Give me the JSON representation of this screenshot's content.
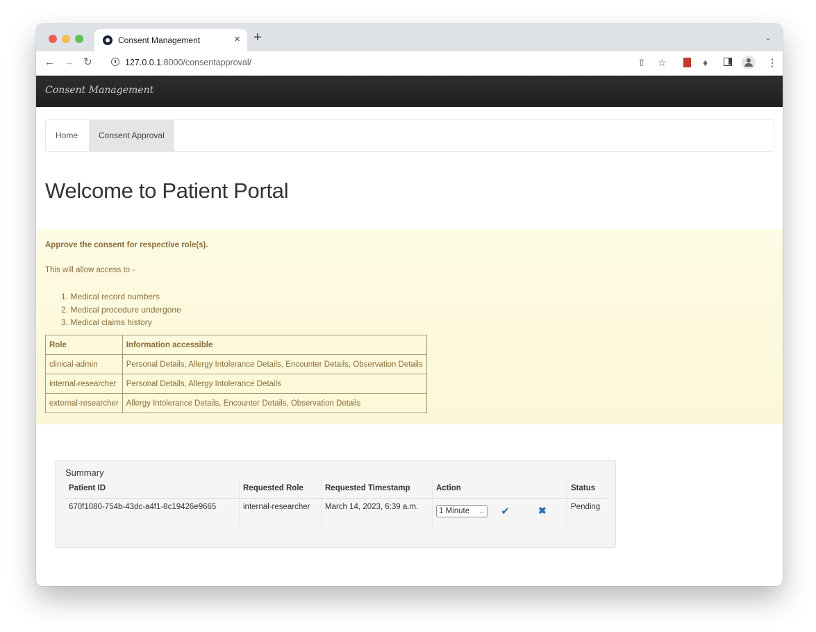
{
  "browser": {
    "tab_title": "Consent Management",
    "tab_close": "×",
    "new_tab": "+",
    "url_host": "127.0.0.1",
    "url_path": ":8000/consentapproval/"
  },
  "app": {
    "brand": "Consent Management",
    "nav": {
      "home": "Home",
      "consent_approval": "Consent Approval",
      "active": "Consent Approval"
    },
    "page_title": "Welcome to Patient Portal"
  },
  "notice": {
    "heading": "Approve the consent for respective role(s).",
    "intro": "This will allow access to -",
    "items": [
      "1. Medical record numbers",
      "2. Medical procedure undergone",
      "3. Medical claims history"
    ],
    "table": {
      "headers": [
        "Role",
        "Information accessible"
      ],
      "rows": [
        [
          "clinical-admin",
          "Personal Details, Allergy Intolerance Details, Encounter Details, Observation Details"
        ],
        [
          "internal-researcher",
          "Personal Details, Allergy Intolerance Details"
        ],
        [
          "external-researcher",
          "Allergy Intolerance Details, Encounter Details, Observation Details"
        ]
      ]
    }
  },
  "summary": {
    "title": "Summary",
    "headers": [
      "Patient ID",
      "Requested Role",
      "Requested Timestamp",
      "Action",
      "Status"
    ],
    "rows": [
      {
        "patient_id": "670f1080-754b-43dc-a4f1-8c19426e9665",
        "role": "internal-researcher",
        "timestamp": "March 14, 2023, 6:39 a.m.",
        "duration": "1 Minute",
        "status": "Pending"
      }
    ]
  },
  "colors": {
    "navbar": "#222222",
    "notice_background": "#fcf8e3",
    "notice_text": "#8a6d3b",
    "action_icons": "#2a6cb8"
  }
}
